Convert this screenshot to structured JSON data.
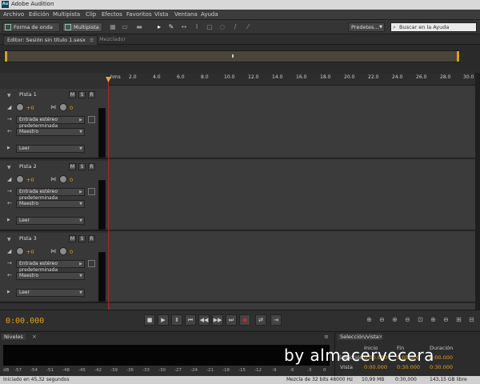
{
  "app": {
    "title": "Adobe Audition",
    "logo_text": "Au"
  },
  "menu": [
    "Archivo",
    "Edición",
    "Multipista",
    "Clip",
    "Efectos",
    "Favoritos",
    "Vista",
    "Ventana",
    "Ayuda"
  ],
  "toolbar": {
    "waveform_label": "Forma de onda",
    "multitrack_label": "Multipista",
    "preset_label": "Predetes...",
    "search_placeholder": "Buscar en la Ayuda"
  },
  "editor": {
    "tab_label": "Editor: Sesión sin título 1.sesx",
    "mixer_label": "Mezclador"
  },
  "ruler": {
    "unit": "hms",
    "ticks": [
      "2.0",
      "4.0",
      "6.0",
      "8.0",
      "10.0",
      "12.0",
      "14.0",
      "16.0",
      "18.0",
      "20.0",
      "22.0",
      "24.0",
      "26.0",
      "28.0",
      "30.0"
    ]
  },
  "tracks": [
    {
      "name": "Pista 1",
      "volume": "+0",
      "pan": "0",
      "input": "Entrada estéreo predeterminada",
      "output": "Maestro",
      "mode": "Leer"
    },
    {
      "name": "Pista 2",
      "volume": "+0",
      "pan": "0",
      "input": "Entrada estéreo predeterminada",
      "output": "Maestro",
      "mode": "Leer"
    },
    {
      "name": "Pista 3",
      "volume": "+0",
      "pan": "0",
      "input": "Entrada estéreo predeterminada",
      "output": "Maestro",
      "mode": "Leer"
    }
  ],
  "track_buttons": {
    "mute": "M",
    "solo": "S",
    "record": "R"
  },
  "transport": {
    "timecode": "0:00.000"
  },
  "levels": {
    "title": "Niveles",
    "scale": [
      "dB",
      "-57",
      "-54",
      "-51",
      "-48",
      "-45",
      "-42",
      "-39",
      "-36",
      "-33",
      "-30",
      "-27",
      "-24",
      "-21",
      "-18",
      "-15",
      "-12",
      "-9",
      "-6",
      "-3",
      "0"
    ]
  },
  "selection": {
    "title": "Selección/vista",
    "headers": [
      "Inicio",
      "Fin",
      "Duración"
    ],
    "rows": [
      {
        "label": "Selección",
        "start": "0:00.000",
        "end": "0:00.000",
        "duration": "0:00.000"
      },
      {
        "label": "Vista",
        "start": "0:00.000",
        "end": "0:30.000",
        "duration": "0:30.000"
      }
    ]
  },
  "watermark": "by almacervecera",
  "status": {
    "left": "Iniciado en 45,32 segundos",
    "format": "Mezcla de 32 bits 48000 Hz",
    "size": "10,99 MB",
    "duration": "0:30,000",
    "free": "143,15 GB libre"
  },
  "colors": {
    "accent": "#e3a21c",
    "playhead": "#b02424"
  }
}
